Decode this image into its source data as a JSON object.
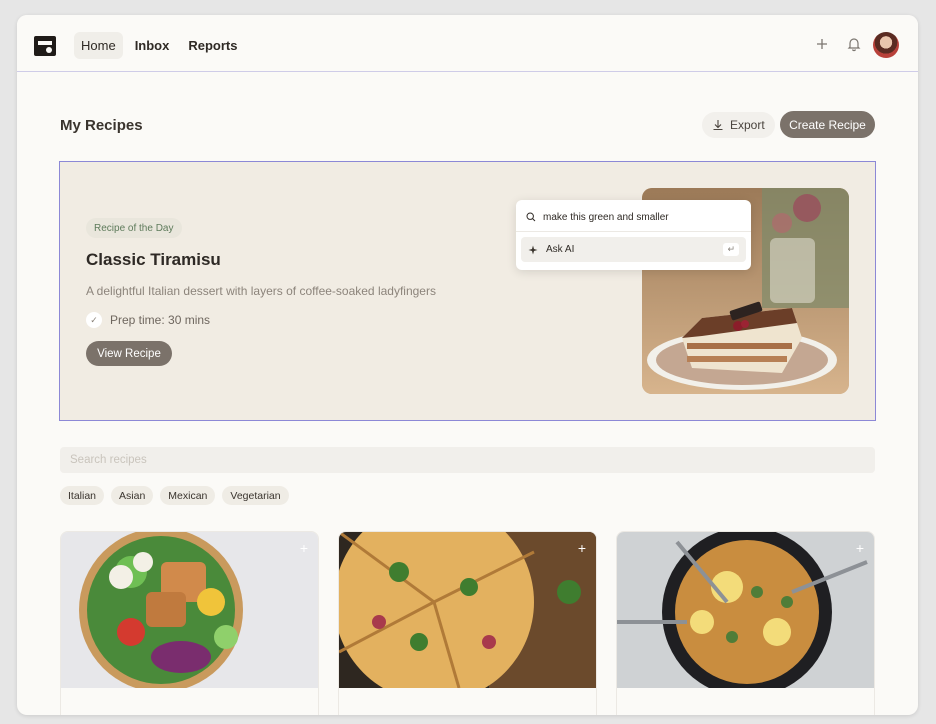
{
  "nav": {
    "items": [
      {
        "label": "Home",
        "active": true
      },
      {
        "label": "Inbox",
        "active": false
      },
      {
        "label": "Reports",
        "active": false
      }
    ]
  },
  "header": {
    "title": "My Recipes",
    "export_label": "Export",
    "create_label": "Create Recipe"
  },
  "hero": {
    "badge": "Recipe of the Day",
    "title": "Classic Tiramisu",
    "description": "A delightful Italian dessert with layers of coffee-soaked ladyfingers",
    "prep": "Prep time: 30 mins",
    "view_label": "View Recipe"
  },
  "ai_popup": {
    "input_value": "make this green and smaller",
    "item_label": "Ask AI",
    "enter_hint": "↵"
  },
  "search": {
    "placeholder": "Search recipes"
  },
  "filters": [
    "Italian",
    "Asian",
    "Mexican",
    "Vegetarian"
  ],
  "cards": [
    {
      "add_label": "+"
    },
    {
      "add_label": "+"
    },
    {
      "add_label": "+"
    }
  ],
  "colors": {
    "accent": "#7b726a",
    "selection_border": "#8c88d6",
    "badge_text": "#5e7b5b"
  }
}
